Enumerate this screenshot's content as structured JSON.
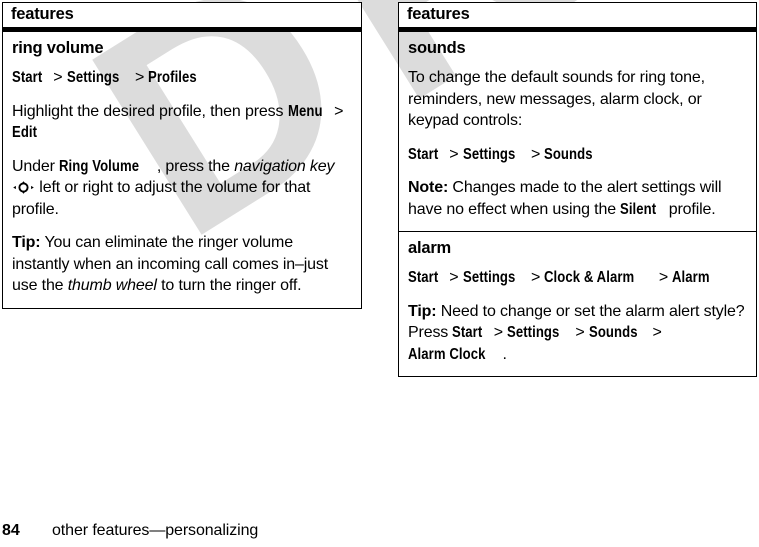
{
  "page": {
    "number": "84",
    "running_title": "other features—personalizing",
    "watermark": "DRAFT",
    "watermark_color": "#dcdcdc"
  },
  "left_column": {
    "header": "features",
    "sections": [
      {
        "title": "ring volume",
        "paragraphs": [
          {
            "id": "path-profiles",
            "runs": [
              {
                "type": "ui",
                "text": "Start"
              },
              {
                "type": "plain",
                "text": " > "
              },
              {
                "type": "ui",
                "text": "Settings"
              },
              {
                "type": "plain",
                "text": " > "
              },
              {
                "type": "ui",
                "text": "Profiles"
              }
            ]
          },
          {
            "id": "highlight-profile",
            "runs": [
              {
                "type": "plain",
                "text": "Highlight the desired profile, then press "
              },
              {
                "type": "ui",
                "text": "Menu"
              },
              {
                "type": "plain",
                "text": " > "
              },
              {
                "type": "ui",
                "text": "Edit"
              }
            ]
          },
          {
            "id": "under-ring-volume",
            "runs": [
              {
                "type": "plain",
                "text": "Under "
              },
              {
                "type": "ui",
                "text": "Ring Volume"
              },
              {
                "type": "plain",
                "text": ", press the "
              },
              {
                "type": "italic",
                "text": "navigation key"
              },
              {
                "type": "navkey",
                "text": ""
              },
              {
                "type": "plain",
                "text": " left or right to adjust the volume for that profile."
              }
            ]
          },
          {
            "id": "tip-ringer",
            "runs": [
              {
                "type": "bold",
                "text": "Tip:"
              },
              {
                "type": "plain",
                "text": " You can eliminate the ringer volume instantly when an incoming call comes in–just use the "
              },
              {
                "type": "italic",
                "text": "thumb wheel"
              },
              {
                "type": "plain",
                "text": " to turn the ringer off."
              }
            ]
          }
        ]
      }
    ]
  },
  "right_column": {
    "header": "features",
    "sections": [
      {
        "title": "sounds",
        "paragraphs": [
          {
            "id": "sounds-intro",
            "runs": [
              {
                "type": "plain",
                "text": "To change the default sounds for ring tone, reminders, new messages, alarm clock, or keypad controls:"
              }
            ]
          },
          {
            "id": "path-sounds",
            "runs": [
              {
                "type": "ui",
                "text": "Start"
              },
              {
                "type": "plain",
                "text": " > "
              },
              {
                "type": "ui",
                "text": "Settings"
              },
              {
                "type": "plain",
                "text": " > "
              },
              {
                "type": "ui",
                "text": "Sounds"
              }
            ]
          },
          {
            "id": "note-silent",
            "runs": [
              {
                "type": "bold",
                "text": "Note:"
              },
              {
                "type": "plain",
                "text": " Changes made to the alert settings will have no effect when using the "
              },
              {
                "type": "ui",
                "text": "Silent"
              },
              {
                "type": "plain",
                "text": " profile."
              }
            ]
          }
        ]
      },
      {
        "title": "alarm",
        "paragraphs": [
          {
            "id": "path-alarm",
            "runs": [
              {
                "type": "ui",
                "text": "Start"
              },
              {
                "type": "plain",
                "text": " > "
              },
              {
                "type": "ui",
                "text": "Settings"
              },
              {
                "type": "plain",
                "text": " > "
              },
              {
                "type": "ui",
                "text": "Clock & Alarm"
              },
              {
                "type": "plain",
                "text": " > "
              },
              {
                "type": "ui",
                "text": "Alarm"
              }
            ]
          },
          {
            "id": "tip-alarm-style",
            "runs": [
              {
                "type": "bold",
                "text": "Tip:"
              },
              {
                "type": "plain",
                "text": " Need to change or set the alarm alert style? Press "
              },
              {
                "type": "ui",
                "text": "Start"
              },
              {
                "type": "plain",
                "text": " > "
              },
              {
                "type": "ui",
                "text": "Settings"
              },
              {
                "type": "plain",
                "text": " > "
              },
              {
                "type": "ui",
                "text": "Sounds"
              },
              {
                "type": "plain",
                "text": " > "
              },
              {
                "type": "ui",
                "text": "Alarm Clock"
              },
              {
                "type": "plain",
                "text": "."
              }
            ]
          }
        ]
      }
    ]
  }
}
